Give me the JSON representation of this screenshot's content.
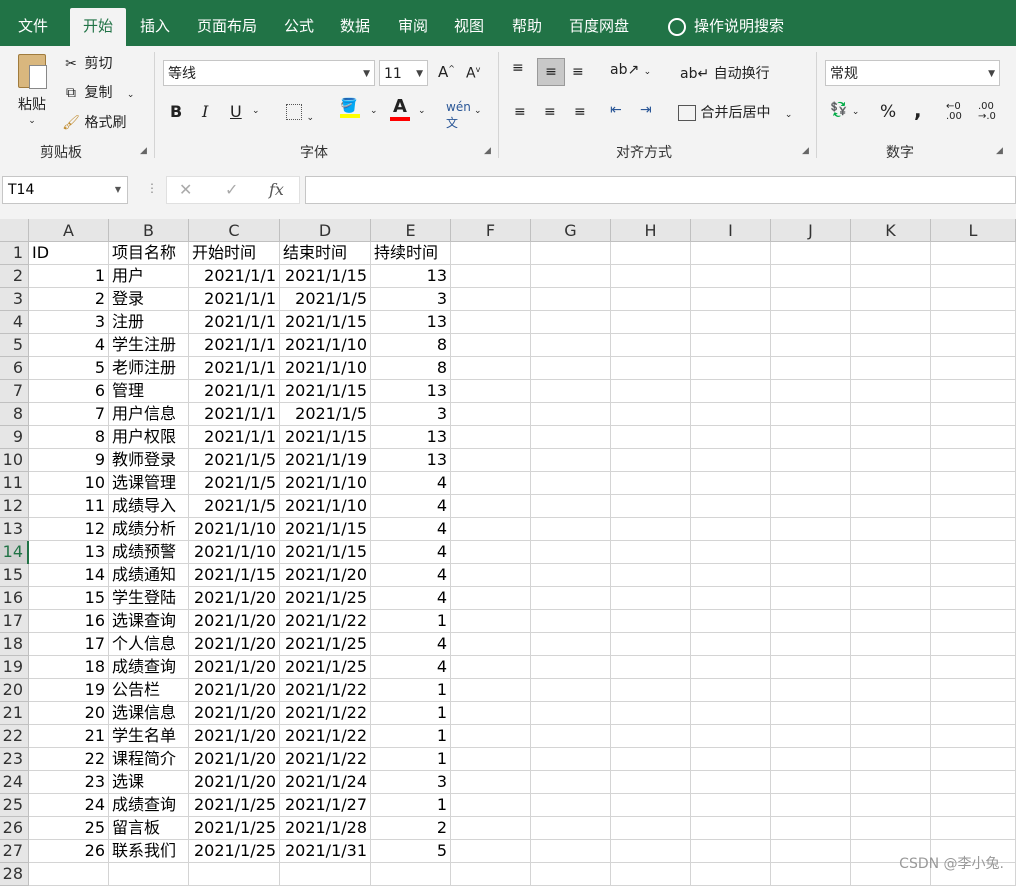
{
  "tabs": [
    "文件",
    "开始",
    "插入",
    "页面布局",
    "公式",
    "数据",
    "审阅",
    "视图",
    "帮助",
    "百度网盘"
  ],
  "tell_me": "操作说明搜索",
  "clipboard": {
    "paste": "粘贴",
    "cut": "剪切",
    "copy": "复制",
    "format_painter": "格式刷",
    "group": "剪贴板"
  },
  "font": {
    "name": "等线",
    "size": "11",
    "group": "字体",
    "bold": "B",
    "italic": "I",
    "underline": "U"
  },
  "alignment": {
    "wrap": "自动换行",
    "merge": "合并后居中",
    "group": "对齐方式"
  },
  "number": {
    "format": "常规",
    "group": "数字",
    "percent": "%",
    "comma": ","
  },
  "formula_bar": {
    "name_box": "T14",
    "cancel": "✕",
    "enter": "✓",
    "fx": "fx"
  },
  "columns": [
    "A",
    "B",
    "C",
    "D",
    "E",
    "F",
    "G",
    "H",
    "I",
    "J",
    "K",
    "L"
  ],
  "rows": [
    [
      "ID",
      "项目名称",
      "开始时间",
      "结束时间",
      "持续时间"
    ],
    [
      "1",
      "用户",
      "2021/1/1",
      "2021/1/15",
      "13"
    ],
    [
      "2",
      "登录",
      "2021/1/1",
      "2021/1/5",
      "3"
    ],
    [
      "3",
      "注册",
      "2021/1/1",
      "2021/1/15",
      "13"
    ],
    [
      "4",
      "学生注册",
      "2021/1/1",
      "2021/1/10",
      "8"
    ],
    [
      "5",
      "老师注册",
      "2021/1/1",
      "2021/1/10",
      "8"
    ],
    [
      "6",
      "管理",
      "2021/1/1",
      "2021/1/15",
      "13"
    ],
    [
      "7",
      "用户信息",
      "2021/1/1",
      "2021/1/5",
      "3"
    ],
    [
      "8",
      "用户权限",
      "2021/1/1",
      "2021/1/15",
      "13"
    ],
    [
      "9",
      "教师登录",
      "2021/1/5",
      "2021/1/19",
      "13"
    ],
    [
      "10",
      "选课管理",
      "2021/1/5",
      "2021/1/10",
      "4"
    ],
    [
      "11",
      "成绩导入",
      "2021/1/5",
      "2021/1/10",
      "4"
    ],
    [
      "12",
      "成绩分析",
      "2021/1/10",
      "2021/1/15",
      "4"
    ],
    [
      "13",
      "成绩预警",
      "2021/1/10",
      "2021/1/15",
      "4"
    ],
    [
      "14",
      "成绩通知",
      "2021/1/15",
      "2021/1/20",
      "4"
    ],
    [
      "15",
      "学生登陆",
      "2021/1/20",
      "2021/1/25",
      "4"
    ],
    [
      "16",
      "选课查询",
      "2021/1/20",
      "2021/1/22",
      "1"
    ],
    [
      "17",
      "个人信息",
      "2021/1/20",
      "2021/1/25",
      "4"
    ],
    [
      "18",
      "成绩查询",
      "2021/1/20",
      "2021/1/25",
      "4"
    ],
    [
      "19",
      "公告栏",
      "2021/1/20",
      "2021/1/22",
      "1"
    ],
    [
      "20",
      "选课信息",
      "2021/1/20",
      "2021/1/22",
      "1"
    ],
    [
      "21",
      "学生名单",
      "2021/1/20",
      "2021/1/22",
      "1"
    ],
    [
      "22",
      "课程简介",
      "2021/1/20",
      "2021/1/22",
      "1"
    ],
    [
      "23",
      "选课",
      "2021/1/20",
      "2021/1/24",
      "3"
    ],
    [
      "24",
      "成绩查询",
      "2021/1/25",
      "2021/1/27",
      "1"
    ],
    [
      "25",
      "留言板",
      "2021/1/25",
      "2021/1/28",
      "2"
    ],
    [
      "26",
      "联系我们",
      "2021/1/25",
      "2021/1/31",
      "5"
    ],
    [
      "",
      "",
      "",
      "",
      ""
    ]
  ],
  "selected_row": 14,
  "watermark": "CSDN @李小兔.",
  "colors": {
    "accent": "#217346"
  }
}
